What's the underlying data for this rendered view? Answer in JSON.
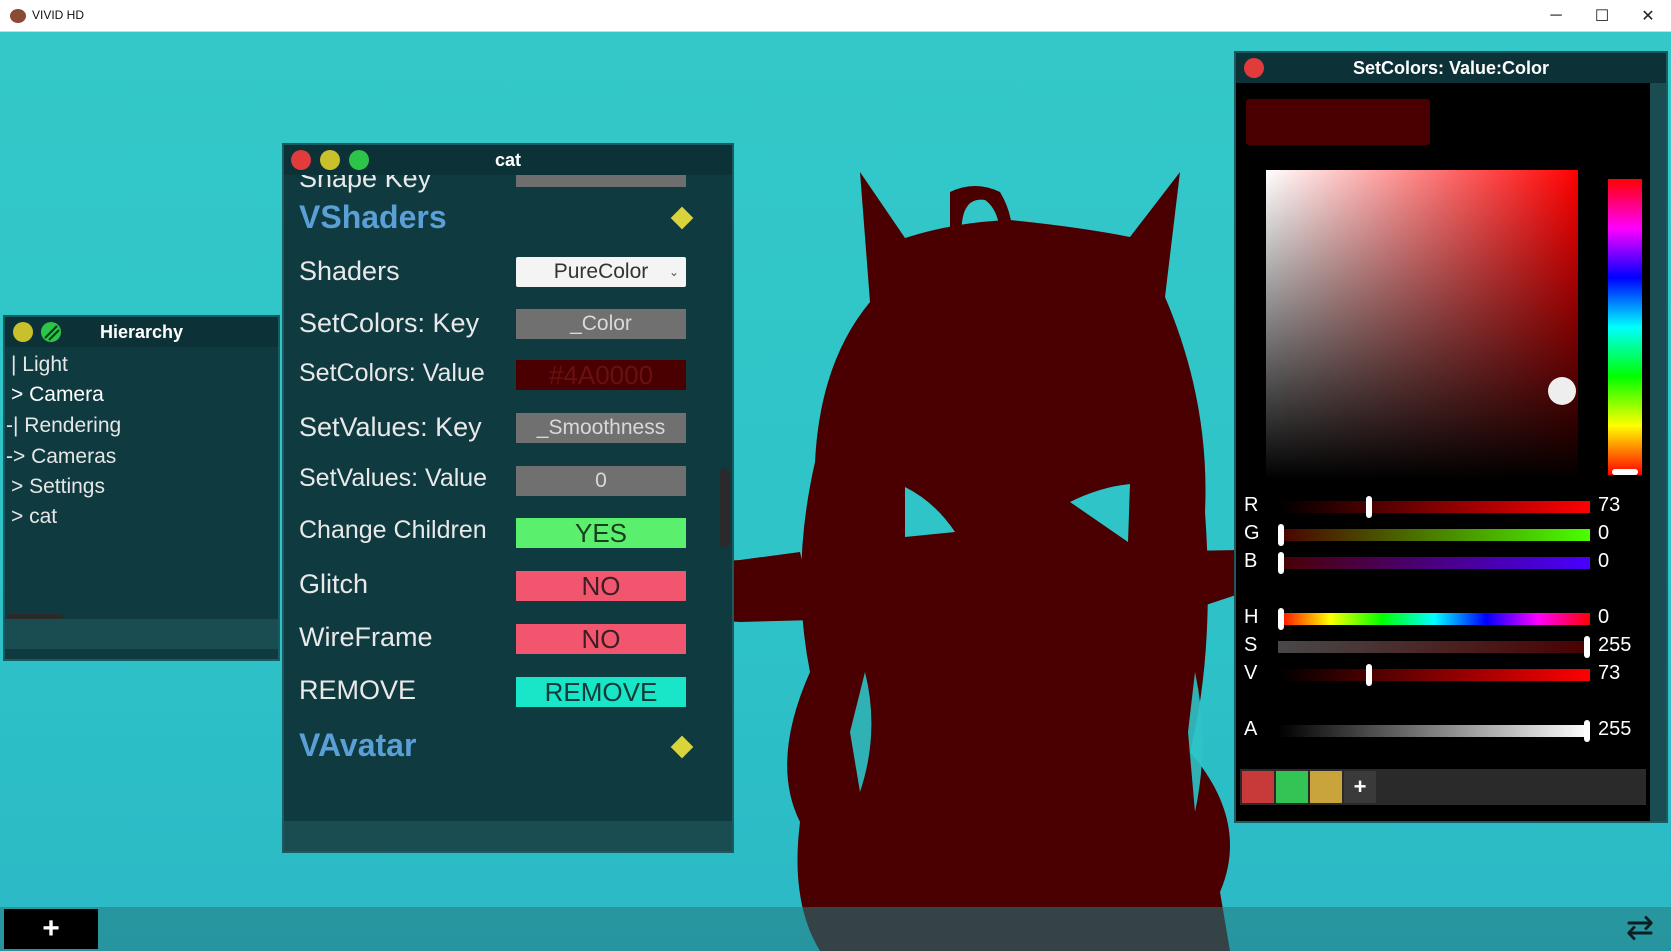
{
  "window": {
    "title": "VIVID HD",
    "minimize": "─",
    "maximize": "☐",
    "close": "✕"
  },
  "hierarchy": {
    "title": "Hierarchy",
    "items": [
      "| Light",
      "> Camera",
      "-| Rendering",
      "-> Cameras",
      "> Settings",
      "> cat"
    ]
  },
  "inspector": {
    "title": "cat",
    "cut_off_row_label": "Shape Key",
    "sections": {
      "vshaders": "VShaders",
      "vavatar": "VAvatar"
    },
    "rows": {
      "shaders_label": "Shaders",
      "shaders_value": "PureColor",
      "setcolors_key_label": "SetColors: Key",
      "setcolors_key_value": "_Color",
      "setcolors_value_label": "SetColors: Value",
      "setcolors_value_value": "#4A0000",
      "setvalues_key_label": "SetValues: Key",
      "setvalues_key_value": "_Smoothness",
      "setvalues_value_label": "SetValues: Value",
      "setvalues_value_value": "0",
      "change_children_label": "Change Children",
      "change_children_value": "YES",
      "glitch_label": "Glitch",
      "glitch_value": "NO",
      "wireframe_label": "WireFrame",
      "wireframe_value": "NO",
      "remove_label": "REMOVE",
      "remove_value": "REMOVE"
    },
    "scroll_fraction": 0.55
  },
  "color_picker": {
    "title": "SetColors: Value:Color",
    "preview_color": "#4A0000",
    "sliders": {
      "r": {
        "label": "R",
        "value": "73",
        "fraction": 0.286
      },
      "g": {
        "label": "G",
        "value": "0",
        "fraction": 0
      },
      "b": {
        "label": "B",
        "value": "0",
        "fraction": 0
      },
      "h": {
        "label": "H",
        "value": "0",
        "fraction": 0
      },
      "s": {
        "label": "S",
        "value": "255",
        "fraction": 1
      },
      "v": {
        "label": "V",
        "value": "73",
        "fraction": 0.286
      },
      "a": {
        "label": "A",
        "value": "255",
        "fraction": 1
      }
    },
    "swatches": [
      "#c83a3a",
      "#33c455",
      "#c9a43a"
    ],
    "add_swatch": "+"
  },
  "bottom_bar": {
    "add": "+",
    "swap": "⇄"
  },
  "colors": {
    "silhouette": "#4A0000",
    "background": "#2ec4c8",
    "yes": "#5af06e",
    "no": "#f2566f",
    "remove": "#19e6c8",
    "section": "#5aa0d6"
  }
}
